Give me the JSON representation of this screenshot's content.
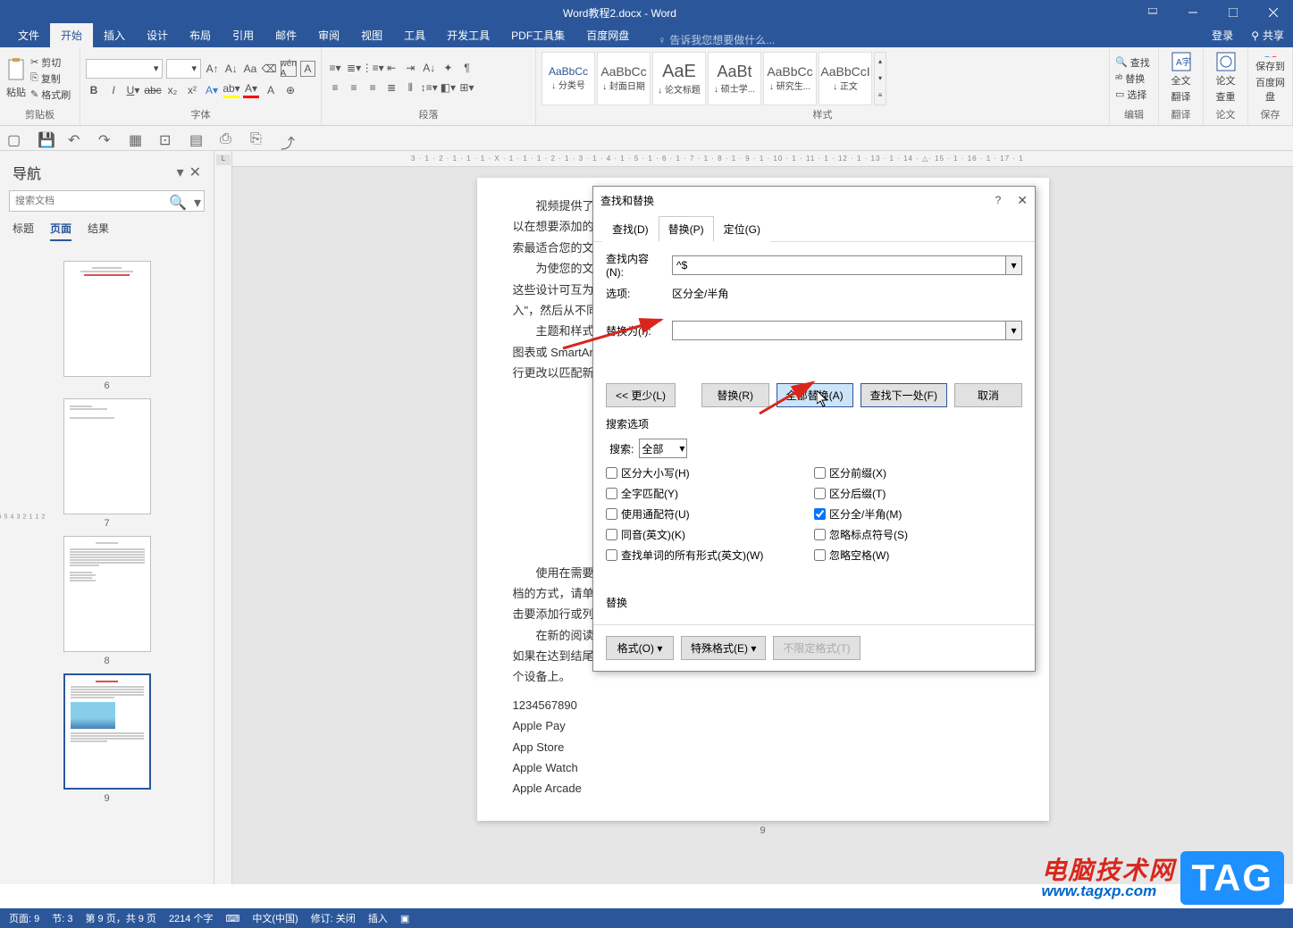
{
  "titlebar": {
    "doc_title": "Word教程2.docx - Word"
  },
  "menubar": {
    "tabs": [
      "文件",
      "开始",
      "插入",
      "设计",
      "布局",
      "引用",
      "邮件",
      "审阅",
      "视图",
      "工具",
      "开发工具",
      "PDF工具集",
      "百度网盘"
    ],
    "tell_me": "告诉我您想要做什么...",
    "login": "登录",
    "share": "共享"
  },
  "ribbon": {
    "clipboard": {
      "paste": "粘贴",
      "cut": "剪切",
      "copy": "复制",
      "format_painter": "格式刷",
      "label": "剪贴板"
    },
    "font": {
      "label": "字体"
    },
    "paragraph": {
      "label": "段落"
    },
    "styles": {
      "label": "样式",
      "items": [
        {
          "sample": "AaBbCc",
          "name": "↓ 分类号"
        },
        {
          "sample": "AaBbCc",
          "name": "↓ 封面日期"
        },
        {
          "sample": "AaE",
          "name": "↓ 论文标题"
        },
        {
          "sample": "AaBt",
          "name": "↓ 硕士学..."
        },
        {
          "sample": "AaBbCc",
          "name": "↓ 研究生..."
        },
        {
          "sample": "AaBbCcI",
          "name": "↓ 正文"
        }
      ]
    },
    "edit": {
      "find": "查找",
      "replace": "替换",
      "select": "选择",
      "label": "编辑"
    },
    "fulltext": {
      "line1": "全文",
      "line2": "翻译",
      "label": "翻译"
    },
    "thesis": {
      "line1": "论文",
      "line2": "查重",
      "label": "论文"
    },
    "baidu": {
      "line1": "保存到",
      "line2": "百度网盘",
      "label": "保存"
    }
  },
  "nav": {
    "title": "导航",
    "search_placeholder": "搜索文档",
    "tabs": [
      "标题",
      "页面",
      "结果"
    ],
    "thumbs": [
      "6",
      "7",
      "8",
      "9"
    ]
  },
  "hruler": "3 · 1 · 2 · 1 · 1 · 1 · X · 1 · 1 · 1 · 2 · 1 · 3 · 1 · 4 · 1 · 5 · 1 · 6 · 1 · 7 · 1 · 8 · 1 · 9 · 1 · 10 · 1 · 11 · 1 · 12 · 1 · 13 · 1 · 14 · △· 15 · 1 · 16 · 1 · 17 · 1",
  "doc": {
    "p1": "视频提供了功能强大的方法帮助您证明您的观点。当您单击联机视频时，可",
    "p2": "以在想要添加的视频",
    "p3": "索最适合您的文档的",
    "p4": "为使您的文档具",
    "p5": "这些设计可互为补充",
    "p6": "入\"，然后从不同库",
    "p7": "主题和样式也有",
    "p8": "图表或 SmartArt 图",
    "p9": "行更改以匹配新的主",
    "p10": "使用在需要位置",
    "p11": "档的方式，请单击该",
    "p12": "击要添加行或列的位",
    "p13": "在新的阅读视图",
    "p14": "如果在达到结尾处之",
    "p15": "个设备上。",
    "l1": "1234567890",
    "l2": "Apple Pay",
    "l3": "App Store",
    "l4": "Apple Watch",
    "l5": "Apple Arcade",
    "page_num": "9"
  },
  "dialog": {
    "title": "查找和替换",
    "tabs": {
      "find": "查找(D)",
      "replace": "替换(P)",
      "goto": "定位(G)"
    },
    "find_label": "查找内容(N):",
    "find_value": "^$",
    "options_label": "选项:",
    "options_value": "区分全/半角",
    "replace_label": "替换为(I):",
    "replace_value": "",
    "less": "<< 更少(L)",
    "replace_btn": "替换(R)",
    "replace_all": "全部替换(A)",
    "find_next": "查找下一处(F)",
    "cancel": "取消",
    "search_options": "搜索选项",
    "search_label": "搜索:",
    "search_value": "全部",
    "chk_case": "区分大小写(H)",
    "chk_whole": "全字匹配(Y)",
    "chk_wildcard": "使用通配符(U)",
    "chk_sounds": "同音(英文)(K)",
    "chk_forms": "查找单词的所有形式(英文)(W)",
    "chk_prefix": "区分前缀(X)",
    "chk_suffix": "区分后缀(T)",
    "chk_width": "区分全/半角(M)",
    "chk_punct": "忽略标点符号(S)",
    "chk_space": "忽略空格(W)",
    "replace_section": "替换",
    "format_btn": "格式(O) ▾",
    "special_btn": "特殊格式(E) ▾",
    "noformat_btn": "不限定格式(T)"
  },
  "status": {
    "page": "页面: 9",
    "section": "节: 3",
    "pages": "第 9 页，共 9 页",
    "words": "2214 个字",
    "lang": "中文(中国)",
    "track": "修订: 关闭",
    "insert": "插入"
  },
  "watermark": {
    "cn": "电脑技术网",
    "url": "www.tagxp.com",
    "tag": "TAG"
  }
}
